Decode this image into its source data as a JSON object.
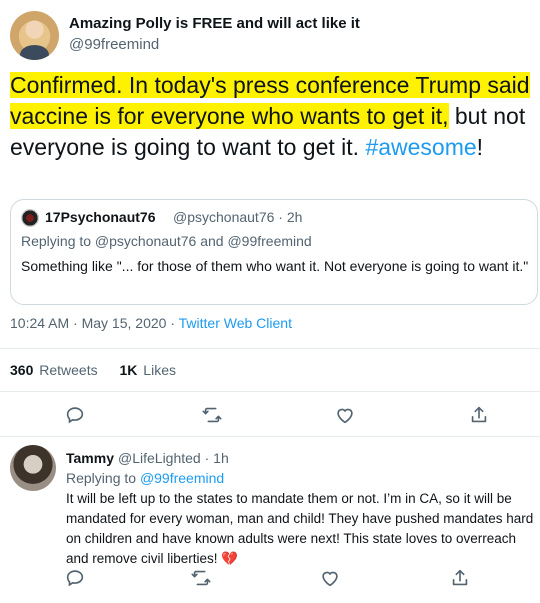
{
  "main_tweet": {
    "display_name": "Amazing Polly is FREE and will act like it",
    "handle": "@99freemind",
    "text_highlighted": "Confirmed. In today's press conference Trump said vaccine is for everyone who wants to get it,",
    "text_rest": " but not everyone is going to want to get it.",
    "hashtag": "#awesome",
    "text_end": "!",
    "highlight_color": "#fff200",
    "link_color": "#1d9bf0"
  },
  "quoted_tweet": {
    "display_name": "17Psychonaut76",
    "handle_time": "@psychonaut76 · 2h",
    "replying_to": "Replying to @psychonaut76 and @99freemind",
    "text": "Something like \"... for those of them who want it. Not everyone is going to want it.\""
  },
  "meta": {
    "timestamp": "10:24 AM · May 15, 2020 · ",
    "source": "Twitter Web Client"
  },
  "stats": {
    "retweets_count": "360",
    "retweets_label": "Retweets",
    "likes_count": "1K",
    "likes_label": "Likes"
  },
  "actions": {
    "icons": [
      "reply-icon",
      "retweet-icon",
      "like-icon",
      "share-icon"
    ]
  },
  "reply_tweet": {
    "display_name": "Tammy",
    "handle_time": "@LifeLighted · 1h",
    "replying_prefix": "Replying to ",
    "replying_mention": "@99freemind",
    "text": "It will be left up to the states to mandate them or not. I’m in CA, so it will be mandated for every woman, man and child! They have pushed mandates hard on children and have known adults were next! This state loves to overreach and remove civil liberties! ",
    "emoji": "💔"
  }
}
